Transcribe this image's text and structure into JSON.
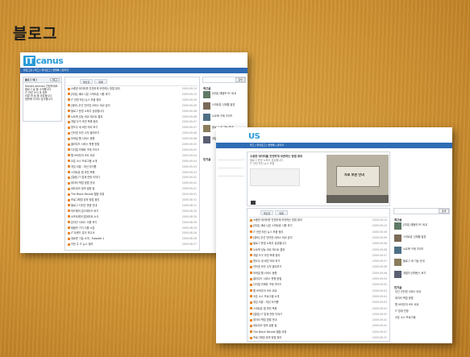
{
  "slide_title": "블로그",
  "screenshot1": {
    "logo_mark": "IT",
    "logo_text": "canus",
    "nav_text": "블로그홈 | 태그 | 위치로그 | 방명록 | 관리자",
    "left_header": "블로그 태그",
    "left_header_btn": "태그",
    "left_box_lines": [
      "Donald Johnson 안녕하세요",
      "블로그 글 을 소개합니다",
      "IT 관련 소식 과 정보",
      "리뷰 와 팁 을 공유합니다",
      "방문해 주셔서 감사합니다"
    ],
    "tab1": "메인글",
    "tab2": "목록",
    "search_btn": "검색",
    "sidebar_header": "최근글",
    "sidebar_items": [
      "[리뷰] 태블릿 PC 비교",
      "스마트폰 신제품 발표",
      "노트북 구매 가이드",
      "블로그 새 기능 안내",
      "개발자 컨퍼런스 후기"
    ],
    "sidebar_header2": "인기글",
    "rows": [
      {
        "t": "소중한 데이터를 안전하게 보관하는 방법 정리",
        "d": "2009.09.10"
      },
      {
        "t": "[리뷰] 새로 나온 스마트폰 사용 후기",
        "d": "2009.09.10"
      },
      {
        "t": "IT 관련 최신 뉴스 모음 정리",
        "d": "2009.09.09"
      },
      {
        "t": "[정보] 무선 인터넷 서비스 비교 분석",
        "d": "2009.09.09"
      },
      {
        "t": "블로그 운영 노하우 공유합니다",
        "d": "2009.09.08"
      },
      {
        "t": "노트북 성능 비교 테스트 결과",
        "d": "2009.09.08"
      },
      {
        "t": "개발 도구 추천 목록 정리",
        "d": "2009.09.07"
      },
      {
        "t": "윈도우 새 버전 미리 보기",
        "d": "2009.09.07"
      },
      {
        "t": "인터넷 보안 수칙 알아보기",
        "d": "2009.09.06"
      },
      {
        "t": "모바일 웹 서비스 동향",
        "d": "2009.09.06"
      },
      {
        "t": "클라우드 서비스 활용 방법",
        "d": "2009.09.05"
      },
      {
        "t": "디지털 카메라 구매 가이드",
        "d": "2009.09.05"
      },
      {
        "t": "웹 브라우저 속도 비교",
        "d": "2009.09.04"
      },
      {
        "t": "오픈 소스 프로그램 소개",
        "d": "2009.09.04"
      },
      {
        "t": "게임 리뷰 - 최신 타이틀",
        "d": "2009.09.03"
      },
      {
        "t": "스마트폰 앱 추천 목록",
        "d": "2009.09.03"
      },
      {
        "t": "[칼럼] IT 업계 전망 이야기",
        "d": "2009.09.02"
      },
      {
        "t": "데이터 백업 방법 안내",
        "d": "2009.09.02"
      },
      {
        "t": "네트워크 장비 설정 팁",
        "d": "2009.09.01"
      },
      {
        "t": "The Black Parade 앨범 리뷰",
        "d": "2009.09.01"
      },
      {
        "t": "프로그래밍 공부 방법 정리",
        "d": "2009.08.31"
      },
      {
        "t": "블로그 디자인 변경 안내",
        "d": "2009.08.31"
      },
      {
        "t": "하드웨어 업그레이드 후기",
        "d": "2009.08.30"
      },
      {
        "t": "소프트웨어 업데이트 소식",
        "d": "2009.08.30"
      },
      {
        "t": "온라인 서비스 이용 후기",
        "d": "2009.08.29"
      },
      {
        "t": "태블릿 기기 사용 소감",
        "d": "2009.08.29"
      },
      {
        "t": "IT 트렌드 분석 보고서",
        "d": "2009.08.28"
      },
      {
        "t": "새로운 기술 소개 - Episode 1",
        "d": "2009.08.28"
      },
      {
        "t": "이번 주 IT 뉴스 정리",
        "d": "2009.08.27"
      }
    ]
  },
  "screenshot2": {
    "logo_text": "US",
    "nav_text": "태그 | 위치로그 | 방명록 | 관리자",
    "featured_lines": [
      "소중한 데이터를 안전하게 보관하는 방법 정리",
      "블로그 운영 노하우 공유합니다",
      "IT 관련 최신 뉴스 모음"
    ],
    "featured_caption": "자료 보관 안내",
    "tab1": "메인글",
    "tab2": "목록",
    "search_btn": "검색",
    "sidebar_header": "최근글",
    "sidebar_items": [
      "[리뷰] 태블릿 PC 비교",
      "스마트폰 신제품 발표",
      "노트북 구매 가이드",
      "블로그 새 기능 안내",
      "개발자 컨퍼런스 후기"
    ],
    "sidebar_header2": "인기글",
    "sidebar_items2": [
      "무선 인터넷 서비스 비교",
      "데이터 백업 방법",
      "웹 브라우저 속도 비교",
      "IT 업계 전망",
      "오픈 소스 프로그램"
    ],
    "rows": [
      {
        "t": "소중한 데이터를 안전하게 보관하는 방법 정리",
        "d": "2009.09.10"
      },
      {
        "t": "[리뷰] 새로 나온 스마트폰 사용 후기",
        "d": "2009.09.10"
      },
      {
        "t": "IT 관련 최신 뉴스 모음 정리",
        "d": "2009.09.09"
      },
      {
        "t": "[정보] 무선 인터넷 서비스 비교 분석",
        "d": "2009.09.09"
      },
      {
        "t": "블로그 운영 노하우 공유합니다",
        "d": "2009.09.08"
      },
      {
        "t": "노트북 성능 비교 테스트 결과",
        "d": "2009.09.08"
      },
      {
        "t": "개발 도구 추천 목록 정리",
        "d": "2009.09.07"
      },
      {
        "t": "윈도우 새 버전 미리 보기",
        "d": "2009.09.07"
      },
      {
        "t": "인터넷 보안 수칙 알아보기",
        "d": "2009.09.06"
      },
      {
        "t": "모바일 웹 서비스 동향",
        "d": "2009.09.06"
      },
      {
        "t": "클라우드 서비스 활용 방법",
        "d": "2009.09.05"
      },
      {
        "t": "디지털 카메라 구매 가이드",
        "d": "2009.09.05"
      },
      {
        "t": "웹 브라우저 속도 비교",
        "d": "2009.09.04"
      },
      {
        "t": "오픈 소스 프로그램 소개",
        "d": "2009.09.04"
      },
      {
        "t": "게임 리뷰 - 최신 타이틀",
        "d": "2009.09.03"
      },
      {
        "t": "스마트폰 앱 추천 목록",
        "d": "2009.09.03"
      },
      {
        "t": "[칼럼] IT 업계 전망 이야기",
        "d": "2009.09.02"
      },
      {
        "t": "데이터 백업 방법 안내",
        "d": "2009.09.02"
      },
      {
        "t": "네트워크 장비 설정 팁",
        "d": "2009.09.01"
      },
      {
        "t": "The Black Parade 앨범 리뷰",
        "d": "2009.09.01"
      },
      {
        "t": "프로그래밍 공부 방법 정리",
        "d": "2009.08.31"
      }
    ]
  },
  "colors": {
    "accent": "#2a9bd6",
    "nav": "#2f6cb5",
    "bullet": "#e8862a",
    "background": "#d49a3a"
  }
}
